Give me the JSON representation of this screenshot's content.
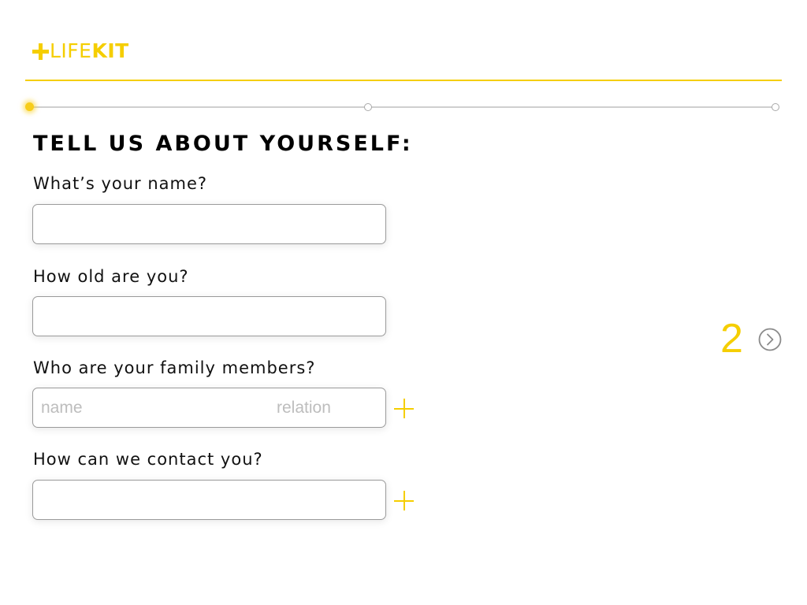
{
  "brand": {
    "logo_thin": "LIFE",
    "logo_bold": "KIT",
    "accent_color": "#f5ce00"
  },
  "progress": {
    "total_steps": 3,
    "current_step": 1
  },
  "form": {
    "title": "TELL US ABOUT YOURSELF:",
    "name_label": "What’s your name?",
    "name_value": "",
    "age_label": "How old are you?",
    "age_value": "",
    "family_label": "Who are your family members?",
    "family_name_placeholder": "name",
    "family_relation_placeholder": "relation",
    "contact_label": "How can we contact you?",
    "contact_value": ""
  },
  "navigation": {
    "next_page_number": "2",
    "next_icon": "chevron-right-circle-icon",
    "add_icon": "plus-icon"
  }
}
